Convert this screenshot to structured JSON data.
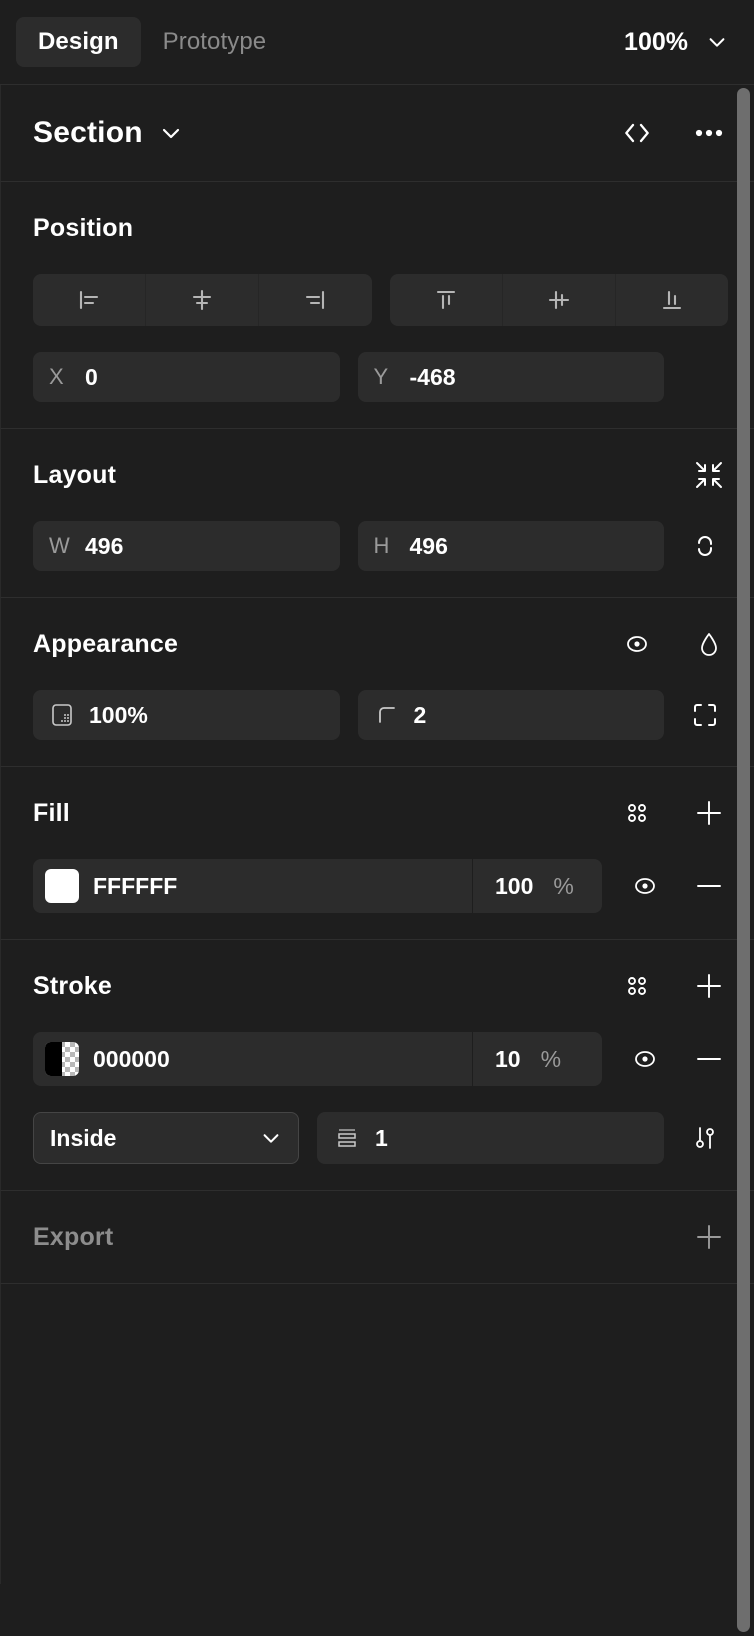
{
  "tabs": {
    "design_label": "Design",
    "prototype_label": "Prototype"
  },
  "zoom": {
    "value": "100%",
    "chevron_icon": "chevron-down-icon"
  },
  "object_header": {
    "name": "Section",
    "chevron_icon": "chevron-down-icon",
    "code_icon": "code-icon",
    "more_icon": "more-options-icon"
  },
  "position": {
    "title": "Position",
    "align_buttons": [
      {
        "name": "align-left",
        "icon": "align-left-icon"
      },
      {
        "name": "align-horizontal-centers",
        "icon": "align-horizontal-center-icon"
      },
      {
        "name": "align-right",
        "icon": "align-right-icon"
      },
      {
        "name": "align-top",
        "icon": "align-top-icon"
      },
      {
        "name": "align-vertical-centers",
        "icon": "align-vertical-center-icon"
      },
      {
        "name": "align-bottom",
        "icon": "align-bottom-icon"
      }
    ],
    "x_label": "X",
    "x_value": "0",
    "y_label": "Y",
    "y_value": "-468"
  },
  "layout": {
    "title": "Layout",
    "resize_icon": "resize-to-fit-icon",
    "w_label": "W",
    "w_value": "496",
    "h_label": "H",
    "h_value": "496",
    "constrain_icon": "constrain-proportions-broken-icon"
  },
  "appearance": {
    "title": "Appearance",
    "visibility_icon": "eye-icon",
    "blend_icon": "blend-mode-droplet-icon",
    "opacity_icon": "opacity-icon",
    "opacity_value": "100%",
    "corner_icon": "corner-radius-icon",
    "corner_value": "2",
    "independent_corners_icon": "independent-corners-icon"
  },
  "fill": {
    "title": "Fill",
    "styles_icon": "styles-grid-icon",
    "add_icon": "plus-icon",
    "swatch_color": "#FFFFFF",
    "hex": "FFFFFF",
    "opacity": "100",
    "percent_symbol": "%",
    "visibility_icon": "eye-icon",
    "remove_icon": "minus-icon"
  },
  "stroke": {
    "title": "Stroke",
    "styles_icon": "styles-grid-icon",
    "add_icon": "plus-icon",
    "swatch_color": "#000000",
    "hex": "000000",
    "opacity": "10",
    "percent_symbol": "%",
    "visibility_icon": "eye-icon",
    "remove_icon": "minus-icon",
    "alignment": "Inside",
    "alignment_chevron_icon": "chevron-down-icon",
    "weight_icon": "stroke-weight-icon",
    "weight_value": "1",
    "advanced_icon": "advanced-stroke-settings-icon"
  },
  "export": {
    "title": "Export",
    "add_icon": "plus-icon"
  },
  "colors": {
    "panel_bg": "#1e1e1e",
    "field_bg": "#2c2c2c",
    "divider": "#2e2e2e",
    "text_primary": "#ffffff",
    "text_muted": "#8d8d8d",
    "scrollbar": "#6e6e6e"
  }
}
